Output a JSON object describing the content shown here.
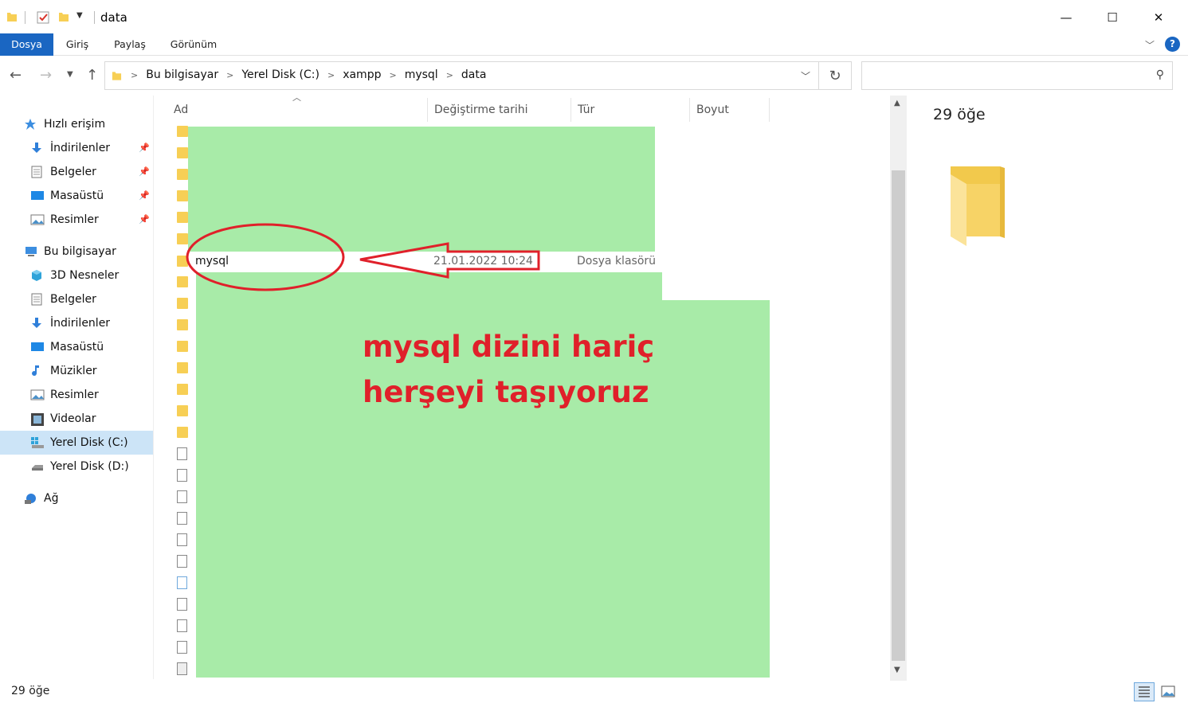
{
  "window": {
    "title": "data",
    "controls": {
      "minimize": "—",
      "maximize": "☐",
      "close": "✕"
    }
  },
  "ribbon": {
    "tabs": [
      "Dosya",
      "Giriş",
      "Paylaş",
      "Görünüm"
    ],
    "active_tab": "Dosya",
    "help": "?"
  },
  "address": {
    "crumbs": [
      "Bu bilgisayar",
      "Yerel Disk (C:)",
      "xampp",
      "mysql",
      "data"
    ],
    "search_placeholder": ""
  },
  "nav": {
    "quick_access": {
      "label": "Hızlı erişim",
      "items": [
        "İndirilenler",
        "Belgeler",
        "Masaüstü",
        "Resimler"
      ]
    },
    "this_pc": {
      "label": "Bu bilgisayar",
      "items": [
        "3D Nesneler",
        "Belgeler",
        "İndirilenler",
        "Masaüstü",
        "Müzikler",
        "Resimler",
        "Videolar",
        "Yerel Disk (C:)",
        "Yerel Disk (D:)"
      ],
      "selected": "Yerel Disk (C:)"
    },
    "network": {
      "label": "Ağ"
    }
  },
  "columns": {
    "name": "Ad",
    "date": "Değiştirme tarihi",
    "type": "Tür",
    "size": "Boyut"
  },
  "visible_row": {
    "name": "mysql",
    "date": "21.01.2022 10:24",
    "type": "Dosya klasörü"
  },
  "annotation": {
    "line1": "mysql dizini hariç",
    "line2": "herşeyi taşıyoruz",
    "color": "#e0202a",
    "mask_color": "#a8eba8"
  },
  "preview": {
    "count": "29 öğe"
  },
  "status": {
    "count": "29 öğe"
  },
  "colors": {
    "accent": "#1a66c2",
    "folder": "#f7cf55",
    "selection": "#cce4f7"
  }
}
